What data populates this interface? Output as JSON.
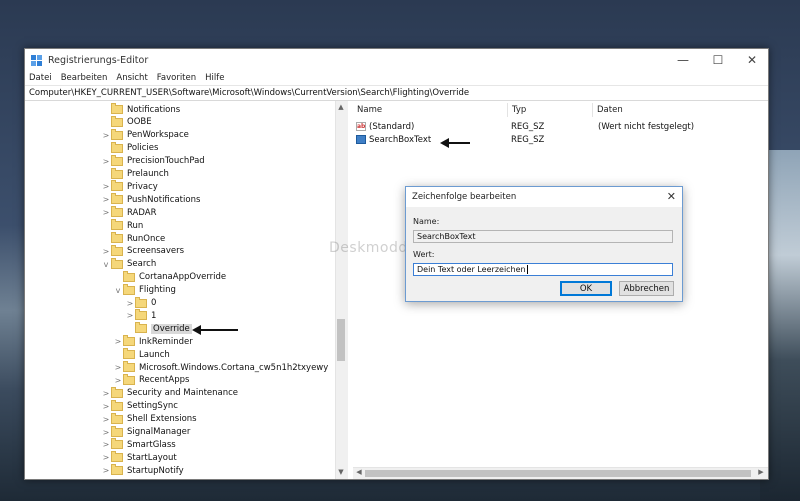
{
  "window": {
    "title": "Registrierungs-Editor",
    "controls": {
      "minimize": "—",
      "maximize": "☐",
      "close": "✕"
    }
  },
  "menu": [
    "Datei",
    "Bearbeiten",
    "Ansicht",
    "Favoriten",
    "Hilfe"
  ],
  "address": "Computer\\HKEY_CURRENT_USER\\Software\\Microsoft\\Windows\\CurrentVersion\\Search\\Flighting\\Override",
  "tree": [
    {
      "label": "Notifications",
      "level": 0,
      "expander": ""
    },
    {
      "label": "OOBE",
      "level": 0,
      "expander": ""
    },
    {
      "label": "PenWorkspace",
      "level": 0,
      "expander": ">"
    },
    {
      "label": "Policies",
      "level": 0,
      "expander": ""
    },
    {
      "label": "PrecisionTouchPad",
      "level": 0,
      "expander": ">"
    },
    {
      "label": "Prelaunch",
      "level": 0,
      "expander": ""
    },
    {
      "label": "Privacy",
      "level": 0,
      "expander": ">"
    },
    {
      "label": "PushNotifications",
      "level": 0,
      "expander": ">"
    },
    {
      "label": "RADAR",
      "level": 0,
      "expander": ">"
    },
    {
      "label": "Run",
      "level": 0,
      "expander": ""
    },
    {
      "label": "RunOnce",
      "level": 0,
      "expander": ""
    },
    {
      "label": "Screensavers",
      "level": 0,
      "expander": ">"
    },
    {
      "label": "Search",
      "level": 0,
      "expander": "v"
    },
    {
      "label": "CortanaAppOverride",
      "level": 1,
      "expander": ""
    },
    {
      "label": "Flighting",
      "level": 1,
      "expander": "v"
    },
    {
      "label": "0",
      "level": 2,
      "expander": ">"
    },
    {
      "label": "1",
      "level": 2,
      "expander": ">"
    },
    {
      "label": "Override",
      "level": 2,
      "expander": "",
      "selected": true
    },
    {
      "label": "InkReminder",
      "level": 1,
      "expander": ">"
    },
    {
      "label": "Launch",
      "level": 1,
      "expander": ""
    },
    {
      "label": "Microsoft.Windows.Cortana_cw5n1h2txyewy",
      "level": 1,
      "expander": ">"
    },
    {
      "label": "RecentApps",
      "level": 1,
      "expander": ">"
    },
    {
      "label": "Security and Maintenance",
      "level": 0,
      "expander": ">"
    },
    {
      "label": "SettingSync",
      "level": 0,
      "expander": ">"
    },
    {
      "label": "Shell Extensions",
      "level": 0,
      "expander": ">"
    },
    {
      "label": "SignalManager",
      "level": 0,
      "expander": ">"
    },
    {
      "label": "SmartGlass",
      "level": 0,
      "expander": ">"
    },
    {
      "label": "StartLayout",
      "level": 0,
      "expander": ">"
    },
    {
      "label": "StartupNotify",
      "level": 0,
      "expander": ">"
    }
  ],
  "columns": {
    "name": "Name",
    "type": "Typ",
    "data": "Daten"
  },
  "values": [
    {
      "icon": "string-value-icon",
      "icon_glyph": "ab",
      "name": "(Standard)",
      "type": "REG_SZ",
      "data": "(Wert nicht festgelegt)"
    },
    {
      "icon": "binary-value-icon",
      "icon_glyph": "",
      "name": "SearchBoxText",
      "type": "REG_SZ",
      "data": ""
    }
  ],
  "watermark": "Deskmodder.de",
  "dialog": {
    "title": "Zeichenfolge bearbeiten",
    "close": "✕",
    "name_label": "Name:",
    "name_value": "SearchBoxText",
    "value_label": "Wert:",
    "value_value": "Dein Text oder Leerzeichen",
    "ok": "OK",
    "cancel": "Abbrechen"
  },
  "scroll": {
    "up": "▲",
    "down": "▼",
    "left": "◀",
    "right": "▶"
  }
}
